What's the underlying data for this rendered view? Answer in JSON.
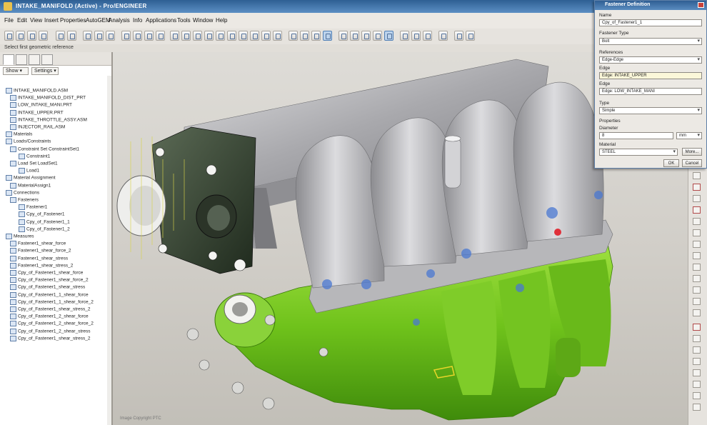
{
  "window": {
    "title": "INTAKE_MANIFOLD (Active) - Pro/ENGINEER",
    "app_icon": "pro-engineer-icon"
  },
  "menu": [
    "File",
    "Edit",
    "View",
    "Insert",
    "Properties",
    "AutoGEM",
    "Analysis",
    "Info",
    "Applications",
    "Tools",
    "Window",
    "Help"
  ],
  "status_line": "Select first geometric reference",
  "navigator": {
    "tabs": [
      "model-tree-icon",
      "folder-icon",
      "layers-icon",
      "favorites-icon"
    ],
    "show_label": "Show",
    "settings_label": "Settings",
    "tree": [
      {
        "label": "INTAKE_MANIFOLD.ASM",
        "level": 0
      },
      {
        "label": "INTAKE_MANIFOLD_DIST_PRT",
        "level": 1
      },
      {
        "label": "LOW_INTAKE_MANI.PRT",
        "level": 1
      },
      {
        "label": "INTAKE_UPPER.PRT",
        "level": 1
      },
      {
        "label": "INTAKE_THROTTLE_ASSY.ASM",
        "level": 1
      },
      {
        "label": "INJECTOR_RAIL.ASM",
        "level": 1
      },
      {
        "label": "Materials",
        "level": 0
      },
      {
        "label": "Loads/Constraints",
        "level": 0
      },
      {
        "label": "Constraint Set ConstraintSet1",
        "level": 1
      },
      {
        "label": "Constraint1",
        "level": 2
      },
      {
        "label": "Load Set LoadSet1",
        "level": 1
      },
      {
        "label": "Load1",
        "level": 2
      },
      {
        "label": "Material Assignment",
        "level": 0
      },
      {
        "label": "MaterialAssign1",
        "level": 1
      },
      {
        "label": "Connections",
        "level": 0
      },
      {
        "label": "Fasteners",
        "level": 1
      },
      {
        "label": "Fastener1",
        "level": 2
      },
      {
        "label": "Cpy_of_Fastener1",
        "level": 2
      },
      {
        "label": "Cpy_of_Fastener1_1",
        "level": 2
      },
      {
        "label": "Cpy_of_Fastener1_2",
        "level": 2
      },
      {
        "label": "Measures",
        "level": 0
      },
      {
        "label": "Fastener1_shear_force",
        "level": 1
      },
      {
        "label": "Fastener1_shear_force_2",
        "level": 1
      },
      {
        "label": "Fastener1_shear_stress",
        "level": 1
      },
      {
        "label": "Fastener1_shear_stress_2",
        "level": 1
      },
      {
        "label": "Cpy_of_Fastener1_shear_force",
        "level": 1
      },
      {
        "label": "Cpy_of_Fastener1_shear_force_2",
        "level": 1
      },
      {
        "label": "Cpy_of_Fastener1_shear_stress",
        "level": 1
      },
      {
        "label": "Cpy_of_Fastener1_1_shear_force",
        "level": 1
      },
      {
        "label": "Cpy_of_Fastener1_1_shear_force_2",
        "level": 1
      },
      {
        "label": "Cpy_of_Fastener1_shear_stress_2",
        "level": 1
      },
      {
        "label": "Cpy_of_Fastener1_2_shear_force",
        "level": 1
      },
      {
        "label": "Cpy_of_Fastener1_2_shear_force_2",
        "level": 1
      },
      {
        "label": "Cpy_of_Fastener1_2_shear_stress",
        "level": 1
      },
      {
        "label": "Cpy_of_Fastener1_shear_stress_2",
        "level": 1
      }
    ]
  },
  "viewport": {
    "caption": "Image Copyright PTC",
    "model_colors": {
      "upper": "#b3b3b6",
      "lower": "#7ccc1f",
      "throttle": "#3f4a3c",
      "background": "#d5d2cc"
    }
  },
  "dialog": {
    "title": "Fastener Definition",
    "name_label": "Name",
    "name_value": "Cpy_of_Fastener1_1",
    "type_label": "Fastener Type",
    "type_value": "Bolt",
    "references_label": "References",
    "references_value": "Edge-Edge",
    "edge1_label": "Edge",
    "edge1_value": "Edge: INTAKE_UPPER",
    "edge2_label": "Edge",
    "edge2_value": "Edge: LOW_INTAKE_MANI",
    "ftype_label": "Type",
    "ftype_value": "Simple",
    "properties_label": "Properties",
    "diameter_label": "Diameter",
    "diameter_value": "8",
    "diameter_units": "mm",
    "material_label": "Material",
    "material_value": "STEEL",
    "more_label": "More...",
    "ok_label": "OK",
    "cancel_label": "Cancel"
  }
}
